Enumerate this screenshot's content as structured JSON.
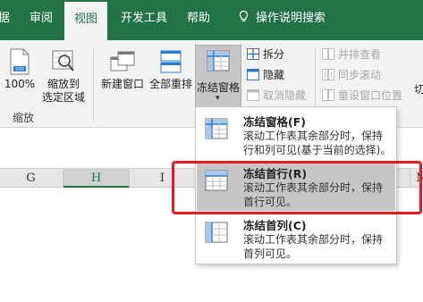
{
  "tabs": [
    {
      "label": "据"
    },
    {
      "label": "审阅"
    },
    {
      "label": "视图"
    },
    {
      "label": "开发工具"
    },
    {
      "label": "帮助"
    },
    {
      "label": "操作说明搜索"
    }
  ],
  "ribbon": {
    "zoom_100": "100%",
    "zoom_selection_l1": "缩放到",
    "zoom_selection_l2": "选定区域",
    "group_zoom": "缩放",
    "new_window": "新建窗口",
    "arrange_all": "全部重排",
    "freeze_panes": "冻结窗格",
    "split": "拆分",
    "hide": "隐藏",
    "unhide": "取消隐藏",
    "view_side_by_side": "并排查看",
    "sync_scroll": "同步滚动",
    "reset_window_pos": "重设窗口位置",
    "switch_window_partial": "切"
  },
  "columns": [
    "G",
    "H",
    "I",
    "",
    "M"
  ],
  "menu": {
    "items": [
      {
        "title": "冻结窗格(F)",
        "desc": "滚动工作表其余部分时，保持行和列可见(基于当前的选择)。"
      },
      {
        "title": "冻结首行(R)",
        "desc": "滚动工作表其余部分时，保持首行可见。"
      },
      {
        "title": "冻结首列(C)",
        "desc": "滚动工作表其余部分时，保持首列可见。"
      }
    ]
  },
  "colors": {
    "accent": "#217346",
    "highlight": "#e8191e"
  }
}
